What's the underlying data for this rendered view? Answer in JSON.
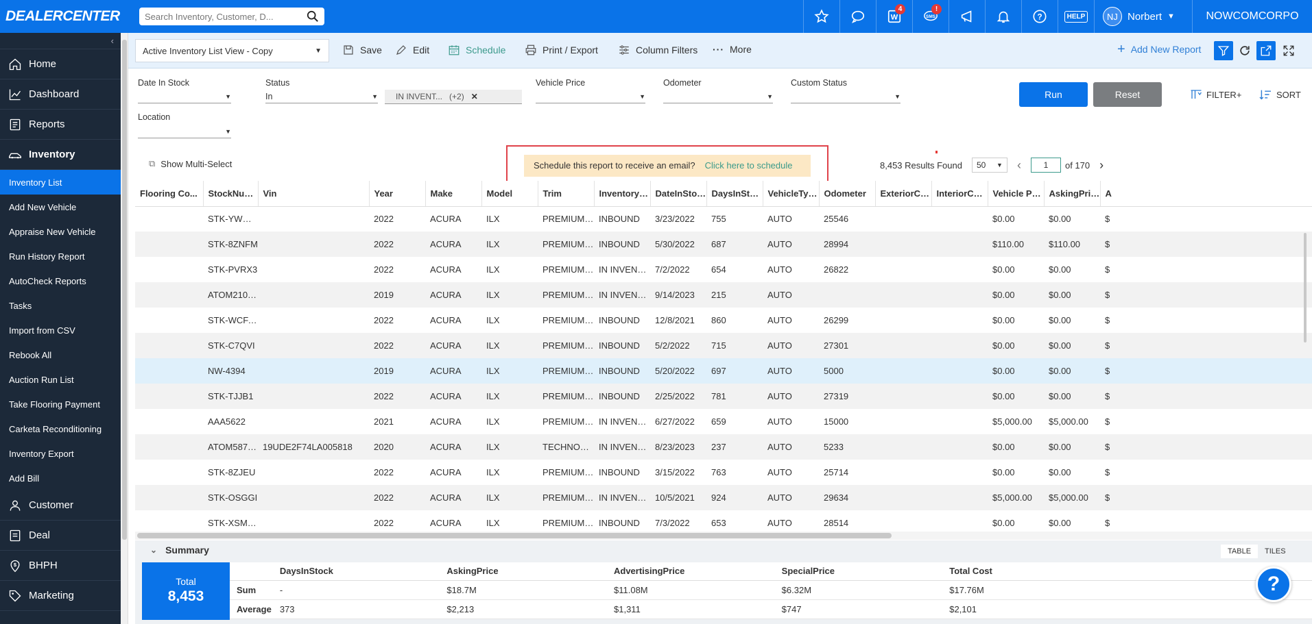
{
  "app": {
    "logo": "DEALERCENTER",
    "search_placeholder": "Search Inventory, Customer, D...",
    "user_initials": "NJ",
    "user_name": "Norbert",
    "dealer": "NOWCOMCORPO",
    "badges": {
      "w": "4",
      "sms": "!"
    },
    "help_label": "HELP",
    "accent": "#0a73e8"
  },
  "sidebar": {
    "main_top": [
      {
        "label": "Home",
        "icon": "home-icon"
      },
      {
        "label": "Dashboard",
        "icon": "chart-icon"
      },
      {
        "label": "Reports",
        "icon": "reports-icon"
      },
      {
        "label": "Inventory",
        "icon": "car-icon"
      }
    ],
    "sub": [
      "Inventory List",
      "Add New Vehicle",
      "Appraise New Vehicle",
      "Run History Report",
      "AutoCheck Reports",
      "Tasks",
      "Import from CSV",
      "Rebook All",
      "Auction Run List",
      "Take Flooring Payment",
      "Carketa Reconditioning",
      "Inventory Export",
      "Add Bill"
    ],
    "main_bottom": [
      {
        "label": "Customer",
        "icon": "person-icon"
      },
      {
        "label": "Deal",
        "icon": "deal-icon"
      },
      {
        "label": "BHPH",
        "icon": "dollar-pin-icon"
      },
      {
        "label": "Marketing",
        "icon": "tag-icon"
      }
    ]
  },
  "toolbar": {
    "view": "Active Inventory List View - Copy",
    "save": "Save",
    "edit": "Edit",
    "schedule": "Schedule",
    "print": "Print / Export",
    "column_filters": "Column Filters",
    "more": "More",
    "add_report": "Add New Report"
  },
  "filters": {
    "date_in_stock": {
      "label": "Date In Stock",
      "value": ""
    },
    "status": {
      "label": "Status",
      "value": "In"
    },
    "status_chip": {
      "text": "IN INVENT...",
      "count": "(+2)"
    },
    "vehicle_price": {
      "label": "Vehicle Price",
      "value": ""
    },
    "odometer": {
      "label": "Odometer",
      "value": ""
    },
    "custom_status": {
      "label": "Custom Status",
      "value": ""
    },
    "location": {
      "label": "Location",
      "value": ""
    },
    "run": "Run",
    "reset": "Reset",
    "filter_plus": "FILTER+",
    "sort": "SORT"
  },
  "grid": {
    "multi_select": "Show Multi-Select",
    "banner_text": "Schedule this report to receive an email?",
    "banner_link": "Click here to schedule",
    "results": "8,453 Results Found",
    "page_size": "50",
    "page": "1",
    "of_pages": "of 170",
    "columns": [
      "Flooring Co...",
      "StockNumber",
      "Vin",
      "Year",
      "Make",
      "Model",
      "Trim",
      "Inventory St...",
      "DateInStock",
      "DaysInStock",
      "VehicleType",
      "Odometer",
      "ExteriorColor",
      "InteriorColor",
      "Vehicle Price",
      "AskingPrice",
      "A"
    ],
    "rows": [
      [
        "",
        "STK-YWOVE",
        "",
        "2022",
        "ACURA",
        "ILX",
        "PREMIUM &...",
        "INBOUND",
        "3/23/2022",
        "755",
        "AUTO",
        "25546",
        "",
        "",
        "$0.00",
        "$0.00",
        "$"
      ],
      [
        "",
        "STK-8ZNFM",
        "",
        "2022",
        "ACURA",
        "ILX",
        "PREMIUM &...",
        "INBOUND",
        "5/30/2022",
        "687",
        "AUTO",
        "28994",
        "",
        "",
        "$110.00",
        "$110.00",
        "$"
      ],
      [
        "",
        "STK-PVRX3",
        "",
        "2022",
        "ACURA",
        "ILX",
        "PREMIUM &...",
        "IN INVENTO...",
        "7/2/2022",
        "654",
        "AUTO",
        "26822",
        "",
        "",
        "$0.00",
        "$0.00",
        "$"
      ],
      [
        "",
        "ATOM21082...",
        "",
        "2019",
        "ACURA",
        "ILX",
        "PREMIUM &...",
        "IN INVENTO...",
        "9/14/2023",
        "215",
        "AUTO",
        "",
        "",
        "",
        "$0.00",
        "$0.00",
        "$"
      ],
      [
        "",
        "STK-WCFAJ",
        "",
        "2022",
        "ACURA",
        "ILX",
        "PREMIUM &...",
        "INBOUND",
        "12/8/2021",
        "860",
        "AUTO",
        "26299",
        "",
        "",
        "$0.00",
        "$0.00",
        "$"
      ],
      [
        "",
        "STK-C7QVI",
        "",
        "2022",
        "ACURA",
        "ILX",
        "PREMIUM &...",
        "INBOUND",
        "5/2/2022",
        "715",
        "AUTO",
        "27301",
        "",
        "",
        "$0.00",
        "$0.00",
        "$"
      ],
      [
        "",
        "NW-4394",
        "",
        "2019",
        "ACURA",
        "ILX",
        "PREMIUM &...",
        "INBOUND",
        "5/20/2022",
        "697",
        "AUTO",
        "5000",
        "",
        "",
        "$0.00",
        "$0.00",
        "$"
      ],
      [
        "",
        "STK-TJJB1",
        "",
        "2022",
        "ACURA",
        "ILX",
        "PREMIUM &...",
        "INBOUND",
        "2/25/2022",
        "781",
        "AUTO",
        "27319",
        "",
        "",
        "$0.00",
        "$0.00",
        "$"
      ],
      [
        "",
        "AAA5622",
        "",
        "2021",
        "ACURA",
        "ILX",
        "PREMIUM &...",
        "IN INVENTO...",
        "6/27/2022",
        "659",
        "AUTO",
        "15000",
        "",
        "",
        "$5,000.00",
        "$5,000.00",
        "$"
      ],
      [
        "",
        "ATOM58712...",
        "19UDE2F74LA005818",
        "2020",
        "ACURA",
        "ILX",
        "TECHNOLO...",
        "IN INVENTO...",
        "8/23/2023",
        "237",
        "AUTO",
        "5233",
        "",
        "",
        "$0.00",
        "$0.00",
        "$"
      ],
      [
        "",
        "STK-8ZJEU",
        "",
        "2022",
        "ACURA",
        "ILX",
        "PREMIUM &...",
        "INBOUND",
        "3/15/2022",
        "763",
        "AUTO",
        "25714",
        "",
        "",
        "$0.00",
        "$0.00",
        "$"
      ],
      [
        "",
        "STK-OSGGI",
        "",
        "2022",
        "ACURA",
        "ILX",
        "PREMIUM &...",
        "IN INVENTO...",
        "10/5/2021",
        "924",
        "AUTO",
        "29634",
        "",
        "",
        "$5,000.00",
        "$5,000.00",
        "$"
      ],
      [
        "",
        "STK-XSMPT",
        "",
        "2022",
        "ACURA",
        "ILX",
        "PREMIUM &...",
        "INBOUND",
        "7/3/2022",
        "653",
        "AUTO",
        "28514",
        "",
        "",
        "$0.00",
        "$0.00",
        "$"
      ]
    ]
  },
  "summary": {
    "title": "Summary",
    "tab_table": "TABLE",
    "tab_tiles": "TILES",
    "total_label": "Total",
    "total_value": "8,453",
    "columns": [
      "",
      "DaysInStock",
      "AskingPrice",
      "AdvertisingPrice",
      "SpecialPrice",
      "Total Cost"
    ],
    "rows": [
      [
        "Sum",
        "-",
        "$18.7M",
        "$11.08M",
        "$6.32M",
        "$17.76M"
      ],
      [
        "Average",
        "373",
        "$2,213",
        "$1,311",
        "$747",
        "$2,101"
      ]
    ]
  },
  "help_fab": "?"
}
